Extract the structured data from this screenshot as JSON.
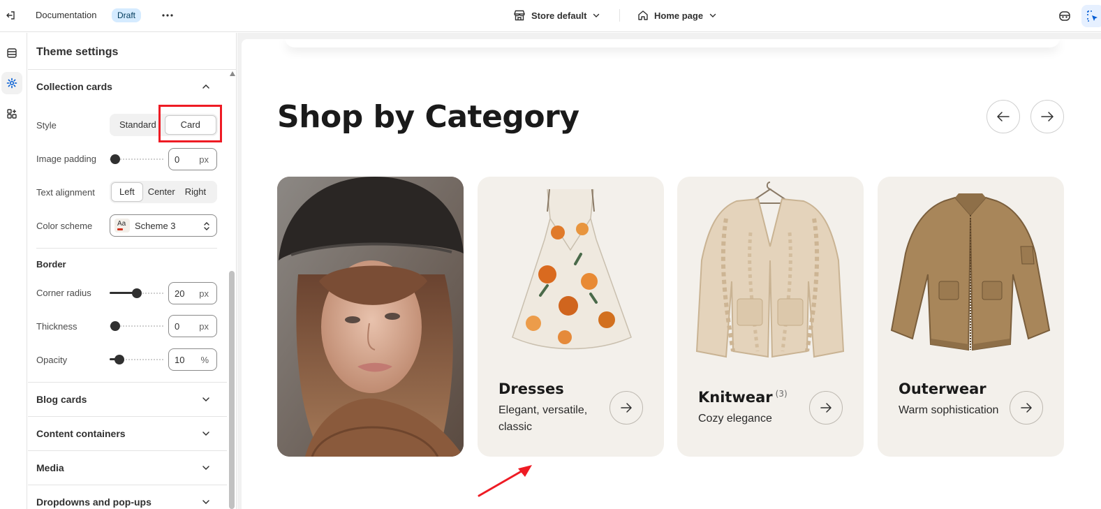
{
  "topbar": {
    "title": "Documentation",
    "status_badge": "Draft",
    "store_label": "Store default",
    "page_label": "Home page"
  },
  "panel": {
    "title": "Theme settings",
    "collection_cards": {
      "title": "Collection cards",
      "style": {
        "label": "Style",
        "options": [
          "Standard",
          "Card"
        ],
        "selected": "Card"
      },
      "image_padding": {
        "label": "Image padding",
        "value": "0",
        "unit": "px",
        "level": 0
      },
      "text_alignment": {
        "label": "Text alignment",
        "options": [
          "Left",
          "Center",
          "Right"
        ],
        "selected": "Left"
      },
      "color_scheme": {
        "label": "Color scheme",
        "swatch_text": "Aa",
        "value": "Scheme 3"
      },
      "border": {
        "title": "Border",
        "corner_radius": {
          "label": "Corner radius",
          "value": "20",
          "unit": "px",
          "level": 0.5
        },
        "thickness": {
          "label": "Thickness",
          "value": "0",
          "unit": "px",
          "level": 0
        },
        "opacity": {
          "label": "Opacity",
          "value": "10",
          "unit": "%",
          "level": 0.1
        }
      }
    },
    "sections": [
      "Blog cards",
      "Content containers",
      "Media",
      "Dropdowns and pop-ups"
    ]
  },
  "preview": {
    "heading": "Shop by Category",
    "cards": [
      {
        "name": "Dresses",
        "count": "",
        "description": "Elegant, versatile, classic"
      },
      {
        "name": "Knitwear",
        "count": "(3)",
        "description": "Cozy elegance"
      },
      {
        "name": "Outerwear",
        "count": "",
        "description": "Warm sophistication"
      }
    ]
  },
  "colors": {
    "accent": "#005bd3",
    "highlight": "#ee1b24",
    "card_bg": "#f3f0eb",
    "badge_bg": "#d5ebff"
  }
}
